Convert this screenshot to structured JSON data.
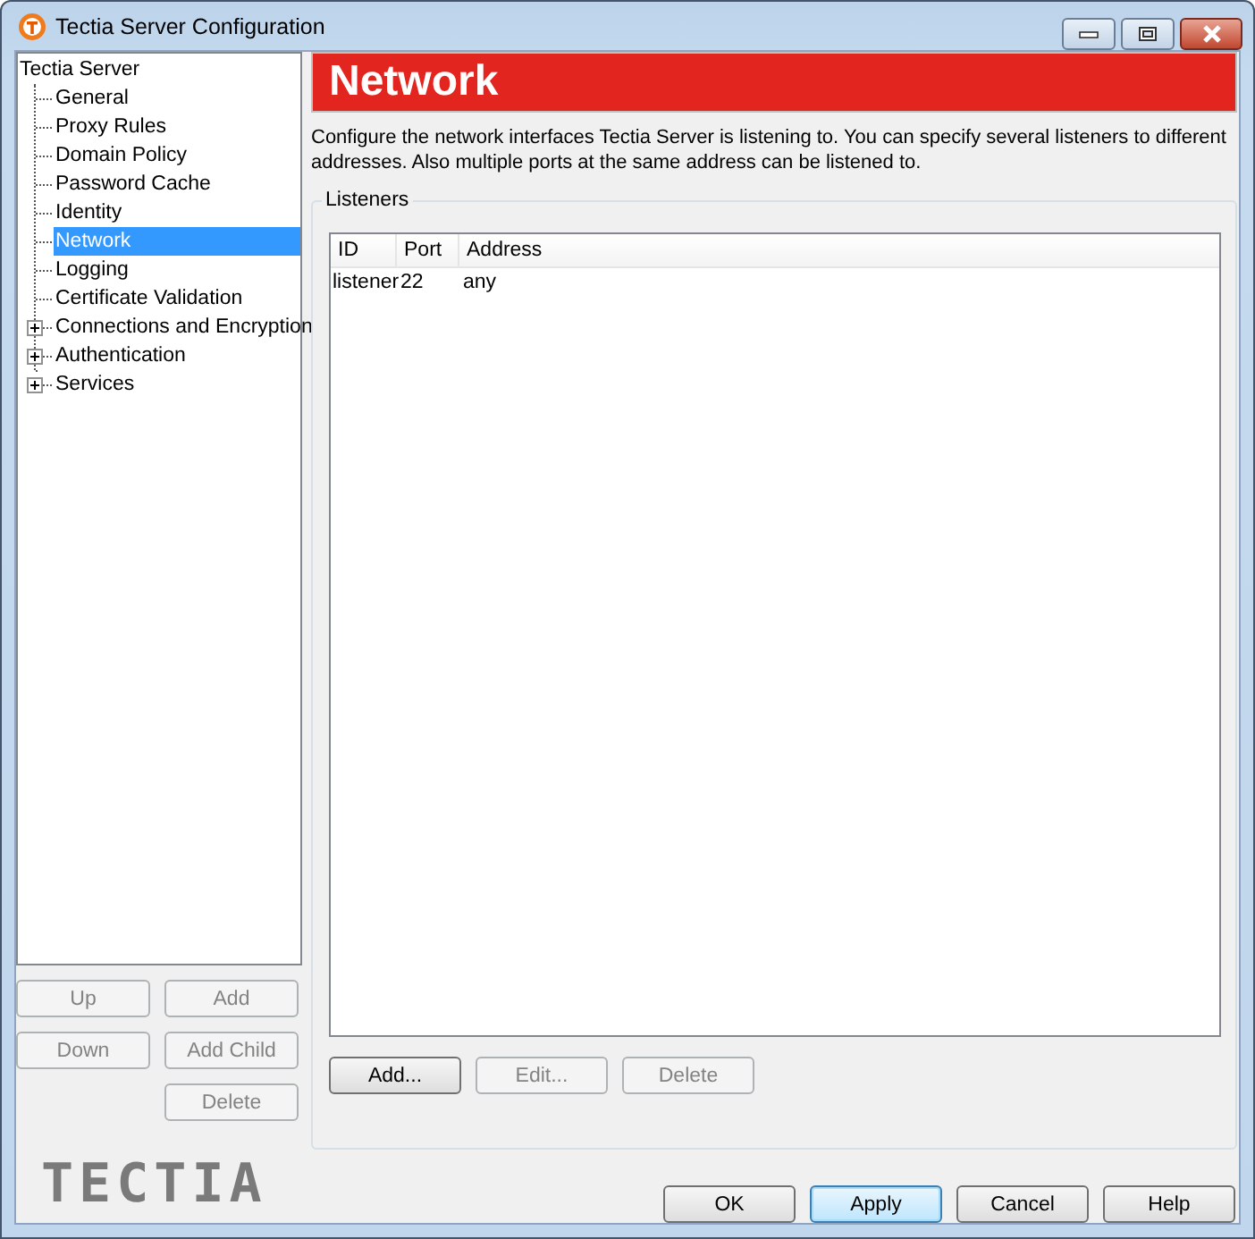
{
  "window": {
    "title": "Tectia Server Configuration"
  },
  "tree": {
    "label": "Tectia Server",
    "selected": false,
    "children": [
      {
        "label": "General",
        "selected": false
      },
      {
        "label": "Proxy Rules",
        "selected": false
      },
      {
        "label": "Domain Policy",
        "selected": false
      },
      {
        "label": "Password Cache",
        "selected": false
      },
      {
        "label": "Identity",
        "selected": false
      },
      {
        "label": "Network",
        "selected": true
      },
      {
        "label": "Logging",
        "selected": false
      },
      {
        "label": "Certificate Validation",
        "selected": false
      },
      {
        "label": "Connections and Encryption",
        "selected": false,
        "expanded": false
      },
      {
        "label": "Authentication",
        "selected": false,
        "expanded": false
      },
      {
        "label": "Services",
        "selected": false,
        "expanded": false
      }
    ]
  },
  "tree_buttons": [
    {
      "label": "Up",
      "disabled": true
    },
    {
      "label": "Add",
      "disabled": true
    },
    {
      "label": "Down",
      "disabled": true
    },
    {
      "label": "Add Child",
      "disabled": true
    },
    {
      "label": "Delete",
      "disabled": true
    }
  ],
  "logo": "TECTIA",
  "page": {
    "heading": "Network",
    "description": "Configure the network interfaces Tectia Server is listening to. You can specify several listeners to different addresses. Also multiple ports at the same address can be listened to.",
    "group": {
      "title": "Listeners",
      "table": {
        "columns": [
          "ID",
          "Port",
          "Address"
        ],
        "rows": [
          [
            "listener",
            "22",
            "any"
          ]
        ]
      },
      "buttons": [
        {
          "label": "Add...",
          "disabled": false
        },
        {
          "label": "Edit...",
          "disabled": true
        },
        {
          "label": "Delete",
          "disabled": true
        }
      ]
    }
  },
  "dialog_buttons": [
    {
      "label": "OK",
      "default": false
    },
    {
      "label": "Apply",
      "default": true
    },
    {
      "label": "Cancel",
      "default": false
    },
    {
      "label": "Help",
      "default": false
    }
  ]
}
